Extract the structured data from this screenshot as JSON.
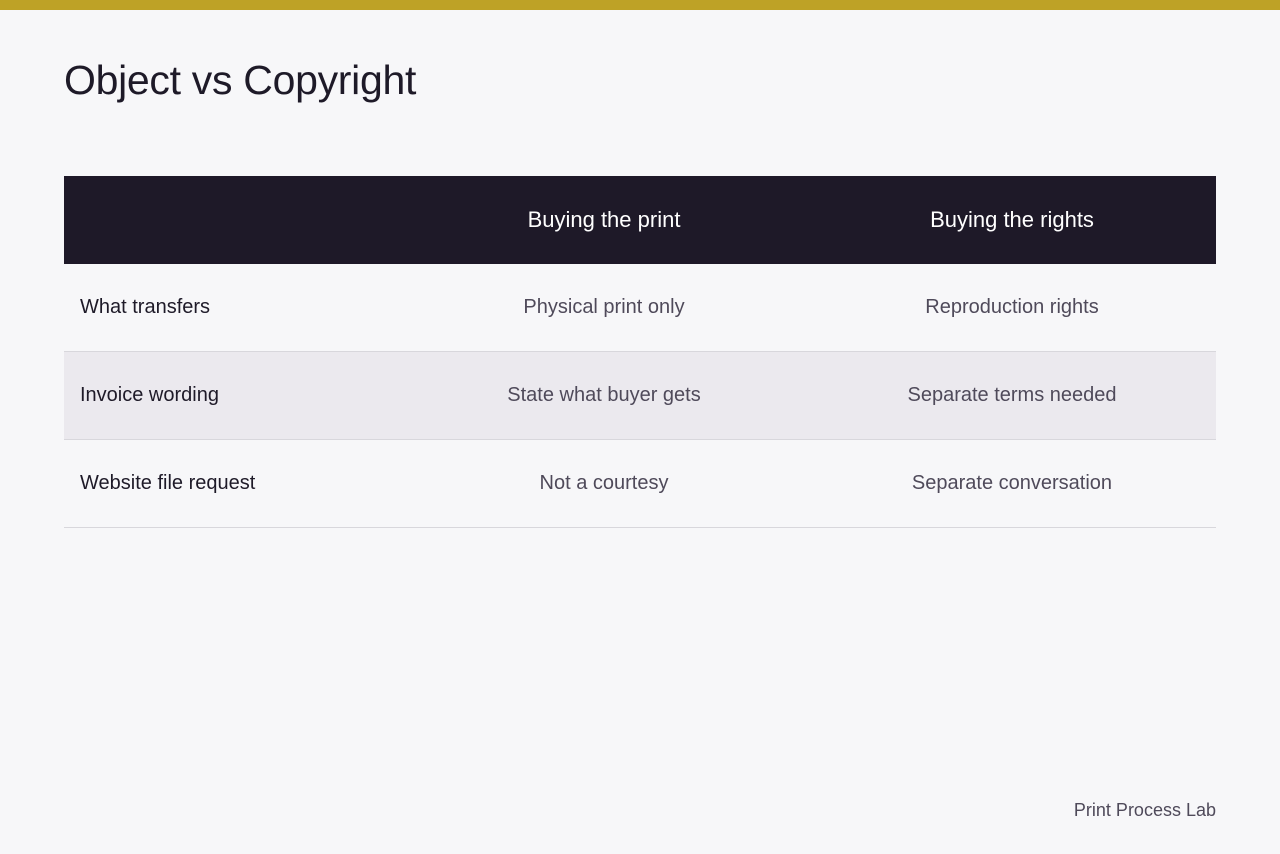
{
  "theme": {
    "accent": "#bea226",
    "header_bg": "#1e1928",
    "background": "#f7f7f9",
    "shaded_row": "#ebe9ee"
  },
  "title": "Object vs Copyright",
  "table": {
    "headers": [
      "",
      "Buying the print",
      "Buying the rights"
    ],
    "rows": [
      {
        "label": "What transfers",
        "print": "Physical print only",
        "rights": "Reproduction rights"
      },
      {
        "label": "Invoice wording",
        "print": "State what buyer gets",
        "rights": "Separate terms needed"
      },
      {
        "label": "Website file request",
        "print": "Not a courtesy",
        "rights": "Separate conversation"
      }
    ]
  },
  "footer": {
    "brand": "Print Process Lab"
  }
}
